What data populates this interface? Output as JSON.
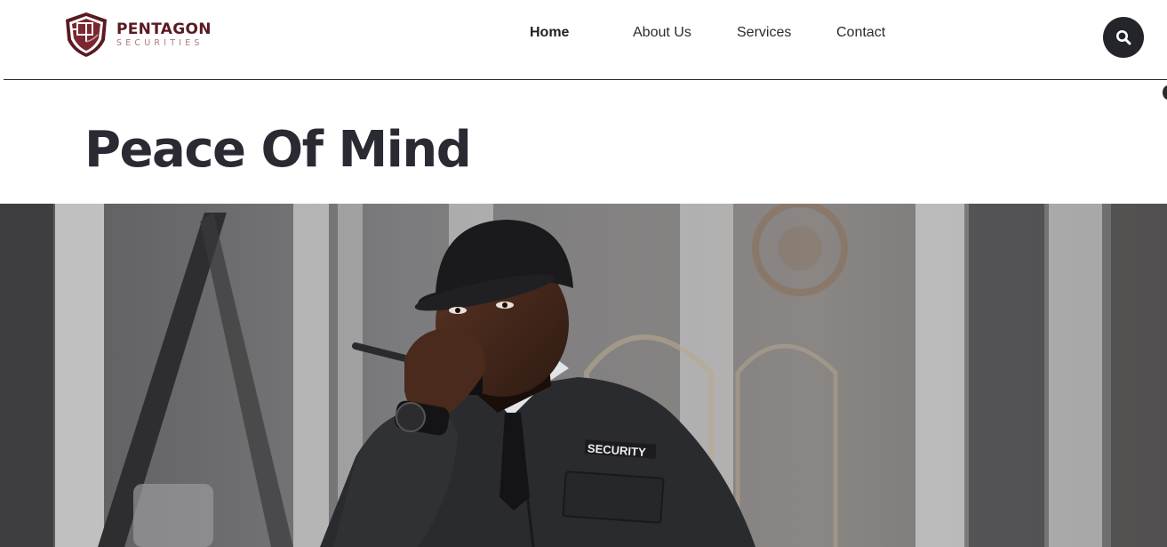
{
  "brand": {
    "name": "PENTAGON",
    "tagline": "SECURITIES",
    "logo_icon": "pentagon-shield-icon"
  },
  "nav": {
    "items": [
      {
        "label": "Home",
        "active": true
      },
      {
        "label": "About Us",
        "active": false
      },
      {
        "label": "Services",
        "active": false
      },
      {
        "label": "Contact",
        "active": false
      }
    ]
  },
  "search": {
    "icon": "search-icon"
  },
  "hero": {
    "title": "Peace Of Mind",
    "image": {
      "subject": "security-guard-with-walkie-talkie",
      "badge_text": "SECURITY"
    }
  },
  "colors": {
    "brand": "#5a1a22",
    "dark": "#24242b",
    "text": "#2a2a33"
  }
}
